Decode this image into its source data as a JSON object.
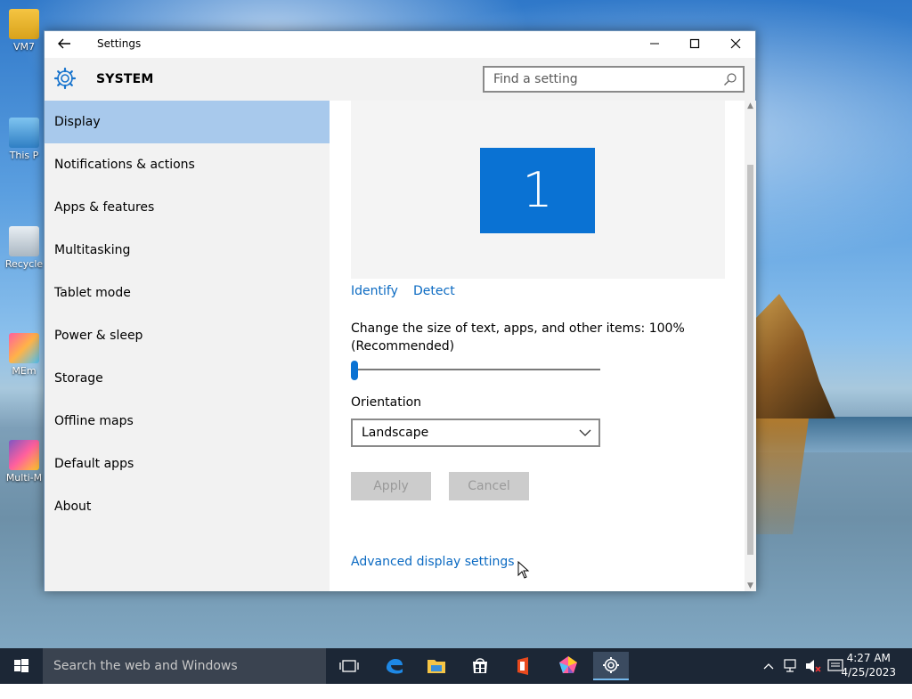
{
  "desktop": {
    "icons": [
      {
        "label": "VM7"
      },
      {
        "label": "This P"
      },
      {
        "label": "Recycle"
      },
      {
        "label": "MEm"
      },
      {
        "label": "Multi-M"
      }
    ]
  },
  "window": {
    "title": "Settings",
    "controls": {
      "minimize": "—",
      "maximize": "☐",
      "close": "✕"
    },
    "section_title": "SYSTEM",
    "search_placeholder": "Find a setting"
  },
  "sidebar": {
    "items": [
      {
        "label": "Display",
        "active": true
      },
      {
        "label": "Notifications & actions"
      },
      {
        "label": "Apps & features"
      },
      {
        "label": "Multitasking"
      },
      {
        "label": "Tablet mode"
      },
      {
        "label": "Power & sleep"
      },
      {
        "label": "Storage"
      },
      {
        "label": "Offline maps"
      },
      {
        "label": "Default apps"
      },
      {
        "label": "About"
      }
    ]
  },
  "display": {
    "monitor_number": "1",
    "identify_label": "Identify",
    "detect_label": "Detect",
    "scale_label": "Change the size of text, apps, and other items: 100% (Recommended)",
    "scale_slider_fraction": 0.0,
    "orientation_label": "Orientation",
    "orientation_value": "Landscape",
    "apply_label": "Apply",
    "cancel_label": "Cancel",
    "advanced_label": "Advanced display settings"
  },
  "taskbar": {
    "search_placeholder": "Search the web and Windows",
    "apps": [
      "task-view-icon",
      "edge-icon",
      "file-explorer-icon",
      "store-icon",
      "office-icon",
      "app-pentagon-icon",
      "settings-icon"
    ],
    "time": "4:27 AM",
    "date": "4/25/2023"
  },
  "colors": {
    "accent": "#0a72d3",
    "sidebar_selected": "#a8c9ec",
    "link": "#0b6ac2",
    "taskbar": "#1c2736"
  }
}
